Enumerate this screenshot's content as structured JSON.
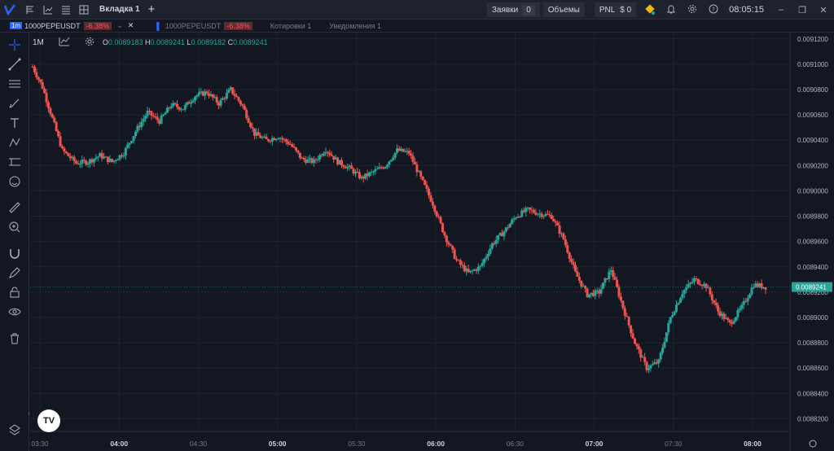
{
  "topbar": {
    "tab_label": "Вкладка 1",
    "orders_label": "Заявки",
    "orders_count": "0",
    "volumes_label": "Объемы",
    "pnl_label": "PNL",
    "pnl_value": "$ 0",
    "clock": "08:05:15"
  },
  "subbar": {
    "timeframe_badge": "1m",
    "symbol": "1000PEPEUSDT",
    "change": "-6.38%",
    "symbol2": "1000PEPEUSDT",
    "change2": "-6.38%",
    "quotes": "Котировки 1",
    "notifications": "Уведомления 1"
  },
  "chart_header": {
    "timeframe": "1M",
    "o_label": "O",
    "o": "0.0089183",
    "h_label": "H",
    "h": "0.0089241",
    "l_label": "L",
    "l": "0.0089182",
    "c_label": "C",
    "c": "0.0089241"
  },
  "chart_data": {
    "type": "candlestick",
    "title": "",
    "y_ticks": [
      "0.0091200",
      "0.0091000",
      "0.0090800",
      "0.0090600",
      "0.0090400",
      "0.0090200",
      "0.0090000",
      "0.0089800",
      "0.0089600",
      "0.0089400",
      "0.0089200",
      "0.0089000",
      "0.0088800",
      "0.0088600",
      "0.0088400",
      "0.0088200"
    ],
    "x_ticks": [
      "03:30",
      "04:00",
      "04:30",
      "05:00",
      "05:30",
      "06:00",
      "06:30",
      "07:00",
      "07:30",
      "08:00"
    ],
    "ylim": [
      0.00881,
      0.009125
    ],
    "last_price": "0.0089241",
    "path_points": [
      [
        0,
        0.009098
      ],
      [
        5,
        0.009082
      ],
      [
        10,
        0.009057
      ],
      [
        15,
        0.009032
      ],
      [
        22,
        0.009022
      ],
      [
        28,
        0.009023
      ],
      [
        34,
        0.009028
      ],
      [
        40,
        0.009023
      ],
      [
        46,
        0.00903
      ],
      [
        52,
        0.009047
      ],
      [
        58,
        0.009062
      ],
      [
        64,
        0.009055
      ],
      [
        70,
        0.009068
      ],
      [
        76,
        0.009065
      ],
      [
        82,
        0.009075
      ],
      [
        88,
        0.009078
      ],
      [
        94,
        0.009069
      ],
      [
        100,
        0.00908
      ],
      [
        106,
        0.009067
      ],
      [
        112,
        0.009045
      ],
      [
        118,
        0.00904
      ],
      [
        124,
        0.009043
      ],
      [
        130,
        0.009037
      ],
      [
        136,
        0.009025
      ],
      [
        142,
        0.009023
      ],
      [
        148,
        0.009033
      ],
      [
        154,
        0.009023
      ],
      [
        160,
        0.009018
      ],
      [
        166,
        0.00901
      ],
      [
        172,
        0.009015
      ],
      [
        178,
        0.00902
      ],
      [
        184,
        0.009032
      ],
      [
        190,
        0.00903
      ],
      [
        196,
        0.00901
      ],
      [
        202,
        0.00899
      ],
      [
        208,
        0.008965
      ],
      [
        214,
        0.008945
      ],
      [
        220,
        0.008935
      ],
      [
        226,
        0.00894
      ],
      [
        232,
        0.008958
      ],
      [
        238,
        0.008968
      ],
      [
        244,
        0.00898
      ],
      [
        250,
        0.008985
      ],
      [
        256,
        0.008982
      ],
      [
        262,
        0.00898
      ],
      [
        268,
        0.008962
      ],
      [
        274,
        0.008935
      ],
      [
        280,
        0.008918
      ],
      [
        286,
        0.00892
      ],
      [
        292,
        0.008938
      ],
      [
        298,
        0.008908
      ],
      [
        304,
        0.00888
      ],
      [
        310,
        0.00886
      ],
      [
        316,
        0.008865
      ],
      [
        322,
        0.0089
      ],
      [
        328,
        0.00892
      ],
      [
        334,
        0.00893
      ],
      [
        340,
        0.008925
      ],
      [
        346,
        0.008905
      ],
      [
        352,
        0.008895
      ],
      [
        358,
        0.008908
      ],
      [
        364,
        0.008926
      ],
      [
        370,
        0.008924
      ]
    ]
  }
}
